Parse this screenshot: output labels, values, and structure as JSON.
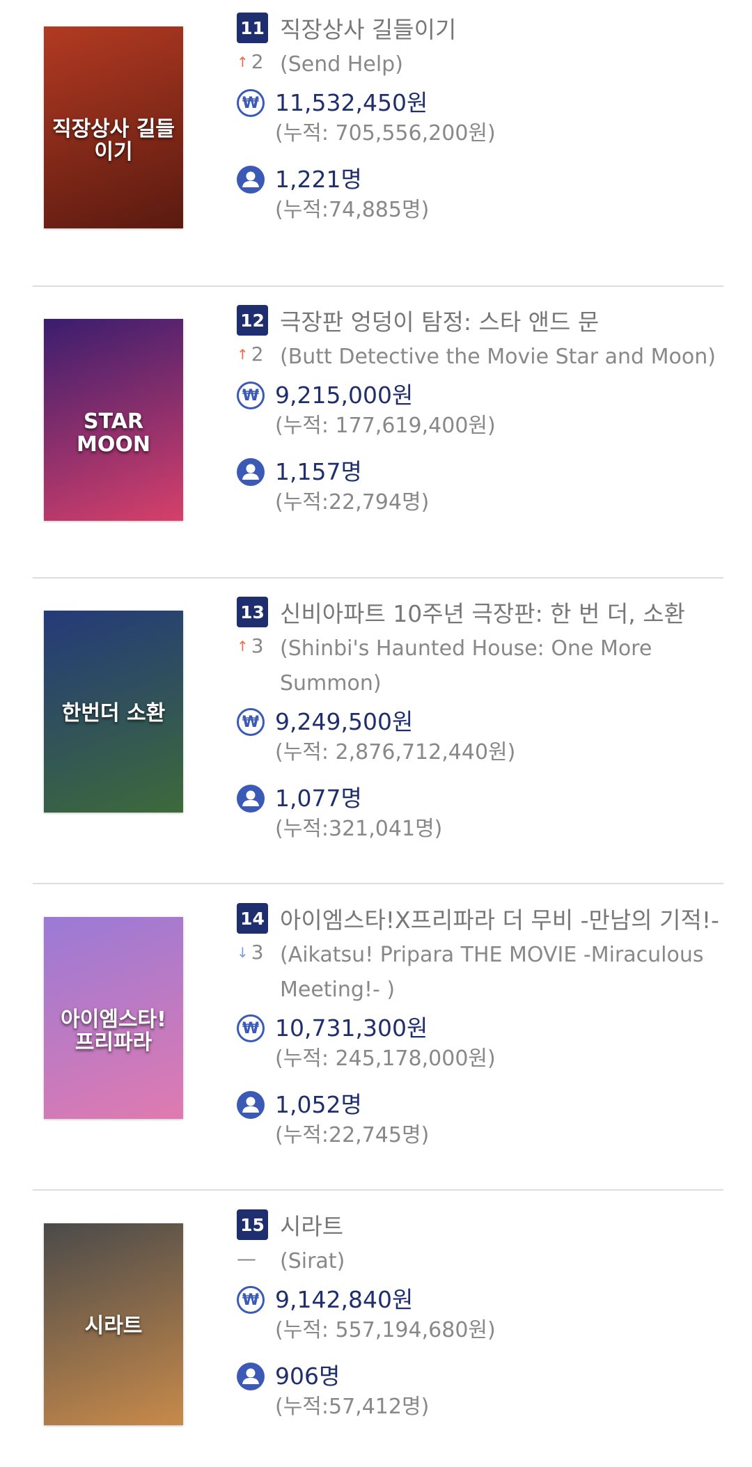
{
  "movies": [
    {
      "rank": "11",
      "change_dir": "up",
      "change_value": "2",
      "title_ko": "직장상사 길들이기",
      "title_en": "(Send Help)",
      "poster_text": "직장상사 길들이기",
      "sales": "11,532,450원",
      "sales_cumulative": "(누적: 705,556,200원)",
      "audience": "1,221명",
      "audience_cumulative": "(누적:74,885명)",
      "poster_colors": [
        "#b23a22",
        "#5a1a10"
      ]
    },
    {
      "rank": "12",
      "change_dir": "up",
      "change_value": "2",
      "title_ko": "극장판 엉덩이 탐정: 스타 앤드 문",
      "title_en": "(Butt Detective the Movie Star and Moon)",
      "poster_text": "STAR MOON",
      "sales": "9,215,000원",
      "sales_cumulative": "(누적: 177,619,400원)",
      "audience": "1,157명",
      "audience_cumulative": "(누적:22,794명)",
      "poster_colors": [
        "#3a1d6e",
        "#d6406a"
      ]
    },
    {
      "rank": "13",
      "change_dir": "up",
      "change_value": "3",
      "title_ko": "신비아파트 10주년 극장판: 한 번 더, 소환",
      "title_en": "(Shinbi's Haunted House: One More Summon)",
      "poster_text": "한번더 소환",
      "sales": "9,249,500원",
      "sales_cumulative": "(누적: 2,876,712,440원)",
      "audience": "1,077명",
      "audience_cumulative": "(누적:321,041명)",
      "poster_colors": [
        "#243a7a",
        "#3d6a3a"
      ]
    },
    {
      "rank": "14",
      "change_dir": "down",
      "change_value": "3",
      "title_ko": "아이엠스타!X프리파라 더 무비 -만남의 기적!-",
      "title_en": "(Aikatsu! Pripara THE MOVIE -Miraculous Meeting!- )",
      "poster_text": "아이엠스타! 프리파라",
      "sales": "10,731,300원",
      "sales_cumulative": "(누적: 245,178,000원)",
      "audience": "1,052명",
      "audience_cumulative": "(누적:22,745명)",
      "poster_colors": [
        "#9a7ad6",
        "#e07ab0"
      ]
    },
    {
      "rank": "15",
      "change_dir": "none",
      "change_value": "—",
      "title_ko": "시라트",
      "title_en": "(Sirat)",
      "poster_text": "시라트",
      "sales": "9,142,840원",
      "sales_cumulative": "(누적: 557,194,680원)",
      "audience": "906명",
      "audience_cumulative": "(누적:57,412명)",
      "poster_colors": [
        "#4a4a4a",
        "#c88a4a"
      ]
    }
  ],
  "icons": {
    "up": "arrow-up-icon",
    "down": "arrow-down-icon",
    "won": "won-icon",
    "person": "person-icon"
  },
  "colors": {
    "rank_badge": "#1e2e6e",
    "stat_text": "#1f2f6e",
    "icon_blue": "#3a5ab5",
    "arrow_up": "#f06a4a",
    "arrow_down": "#7f9be0"
  }
}
